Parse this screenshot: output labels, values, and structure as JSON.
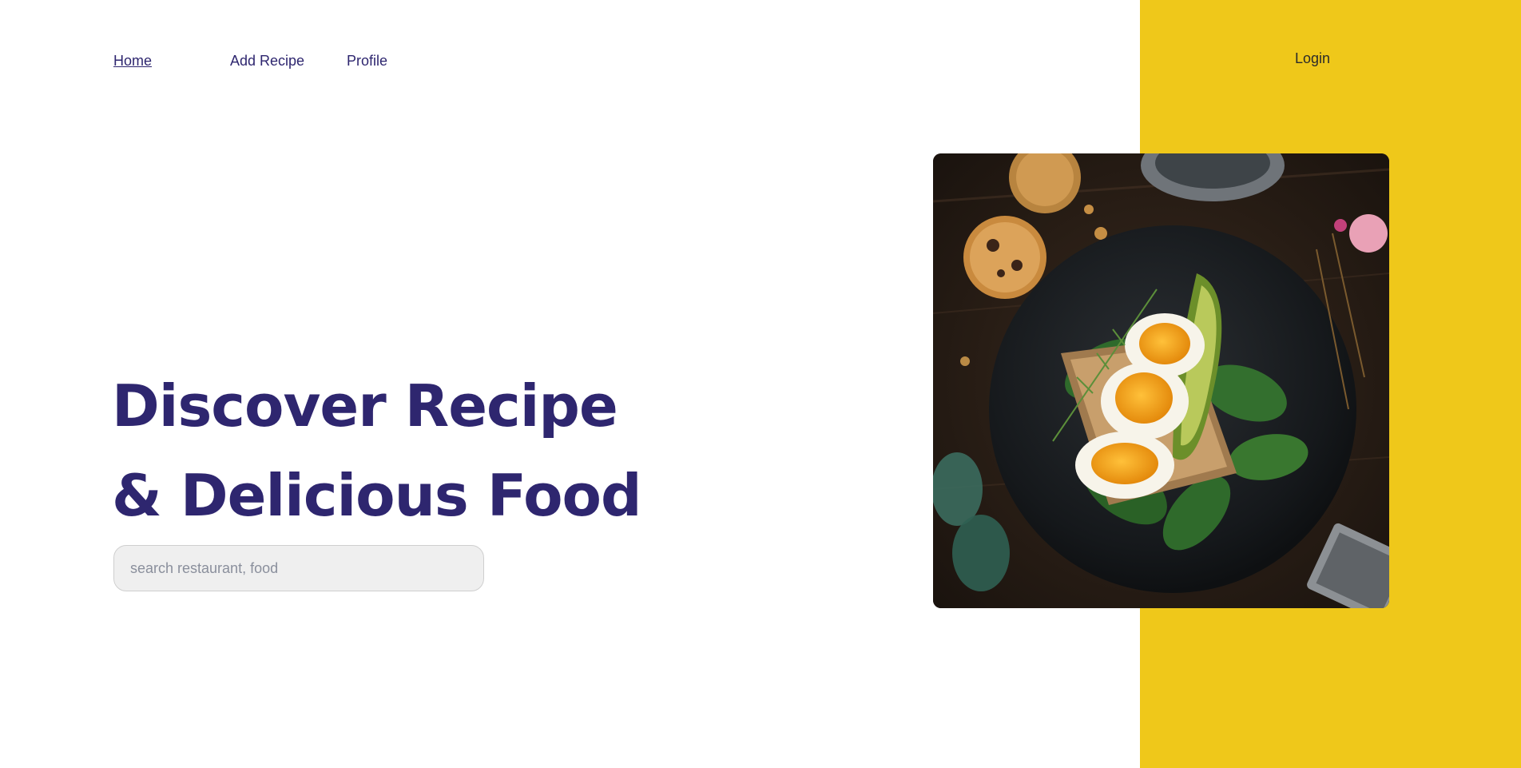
{
  "nav": {
    "items": [
      {
        "label": "Home",
        "active": true
      },
      {
        "label": "Add Recipe",
        "active": false
      },
      {
        "label": "Profile",
        "active": false
      }
    ],
    "login_label": "Login"
  },
  "hero": {
    "title_line1": "Discover Recipe",
    "title_line2": "& Delicious Food",
    "search_placeholder": "search restaurant, food"
  },
  "image": {
    "subject": "egg-avocado-toast-photo"
  },
  "colors": {
    "primary_text": "#2e266f",
    "accent_panel": "#efc81a",
    "search_bg": "#efefef"
  }
}
